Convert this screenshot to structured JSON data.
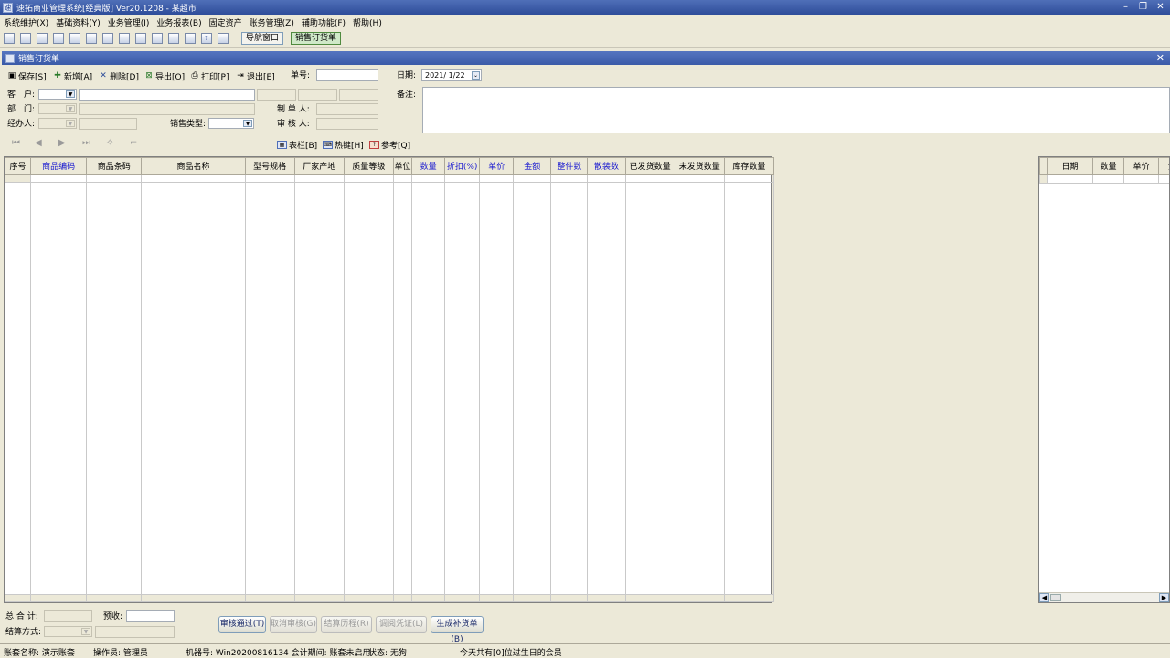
{
  "window": {
    "title": "速拓商业管理系统[经典版] Ver20.1208  - 某超市"
  },
  "menu": [
    "系统维护(X)",
    "基础资料(Y)",
    "业务管理(I)",
    "业务报表(B)",
    "固定资产",
    "账务管理(Z)",
    "辅助功能(F)",
    "帮助(H)"
  ],
  "toolbar": {
    "nav_window": "导航窗口",
    "sales_order": "销售订货单"
  },
  "child_window": {
    "title": "销售订货单"
  },
  "doc_toolbar": {
    "save": "保存[S]",
    "add": "新增[A]",
    "delete": "删除[D]",
    "export": "导出[O]",
    "print": "打印[P]",
    "exit": "退出[E]",
    "order_no_label": "单号:",
    "order_no_value": "",
    "date_label": "日期:",
    "date_value": "2021/ 1/22"
  },
  "form": {
    "customer_label": "客　户:",
    "dept_label": "部　门:",
    "handler_label": "经办人:",
    "sales_type_label": "销售类型:",
    "maker_label": "制 单 人:",
    "auditor_label": "审 核 人:",
    "remark_label": "备注:"
  },
  "nav": {
    "columns_btn": "表栏[B]",
    "hotkey_btn": "热键[H]",
    "reference_btn": "参考[Q]"
  },
  "grid": {
    "headers": [
      "序号",
      "商品编码",
      "商品条码",
      "商品名称",
      "型号规格",
      "厂家产地",
      "质量等级",
      "单位",
      "数量",
      "折扣(%)",
      "单价",
      "金额",
      "整件数",
      "散装数",
      "已发货数量",
      "未发货数量",
      "库存数量"
    ],
    "blue_headers": [
      "商品编码",
      "数量",
      "折扣(%)",
      "单价",
      "金额",
      "整件数",
      "散装数"
    ]
  },
  "right_grid": {
    "headers": [
      "日期",
      "数量",
      "单价",
      "金"
    ]
  },
  "footer": {
    "total_label": "总 合 计:",
    "prepaid_label": "预收:",
    "settle_label": "结算方式:",
    "btn_approve": "审核通过(T)",
    "btn_cancel_approve": "取消审核(G)",
    "btn_settle_history": "结算历程(R)",
    "btn_view_voucher": "调阅凭证(L)",
    "btn_generate": "生成补货单(B)"
  },
  "status": {
    "account": "账套名称: 演示账套",
    "operator": "操作员: 管理员",
    "machine": "机器号: Win20200816134 会计期间: 账套未启用",
    "state": "状态: 无狗",
    "birthday": "今天共有[0]位过生日的会员"
  },
  "colors": {
    "title_bar": "#2e4d9a",
    "blue_header": "#1a1ad0"
  }
}
